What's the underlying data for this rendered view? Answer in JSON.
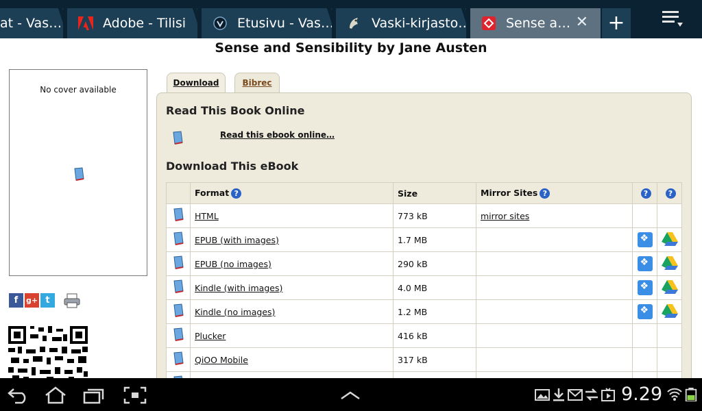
{
  "browser": {
    "tabs": [
      {
        "title": "at - Vas…"
      },
      {
        "title": "Adobe - Tilisi"
      },
      {
        "title": "Etusivu - Vas…"
      },
      {
        "title": "Vaski-kirjasto…"
      },
      {
        "title": "Sense a…",
        "active": true
      }
    ],
    "new_tab_label": "+",
    "close_label": "✕"
  },
  "page": {
    "title": "Sense and Sensibility by Jane Austen",
    "cover_text": "No cover available",
    "tabs": [
      {
        "label": "Download"
      },
      {
        "label": "Bibrec"
      }
    ],
    "read_heading": "Read This Book Online",
    "read_link": "Read this ebook online…",
    "download_heading": "Download This eBook",
    "table": {
      "headers": {
        "format": "Format",
        "size": "Size",
        "mirrors": "Mirror Sites"
      },
      "help_glyph": "?",
      "rows": [
        {
          "format": "HTML",
          "size": "773 kB",
          "mirror": "mirror sites",
          "cloud": false
        },
        {
          "format": "EPUB (with images)",
          "size": "1.7 MB",
          "mirror": "",
          "cloud": true
        },
        {
          "format": "EPUB (no images)",
          "size": "290 kB",
          "mirror": "",
          "cloud": true
        },
        {
          "format": "Kindle (with images)",
          "size": "4.0 MB",
          "mirror": "",
          "cloud": true
        },
        {
          "format": "Kindle (no images)",
          "size": "1.2 MB",
          "mirror": "",
          "cloud": true
        },
        {
          "format": "Plucker",
          "size": "416 kB",
          "mirror": "",
          "cloud": false
        },
        {
          "format": "QiOO Mobile",
          "size": "317 kB",
          "mirror": "",
          "cloud": false
        }
      ]
    },
    "social": [
      "f",
      "g+",
      "t"
    ]
  },
  "system": {
    "clock": "9.29"
  },
  "colors": {
    "tabbar": "#0b2232",
    "tab": "#1d3f55",
    "active_tab": "#5e7180",
    "panel": "#eeebdd",
    "help": "#2a62c8"
  }
}
